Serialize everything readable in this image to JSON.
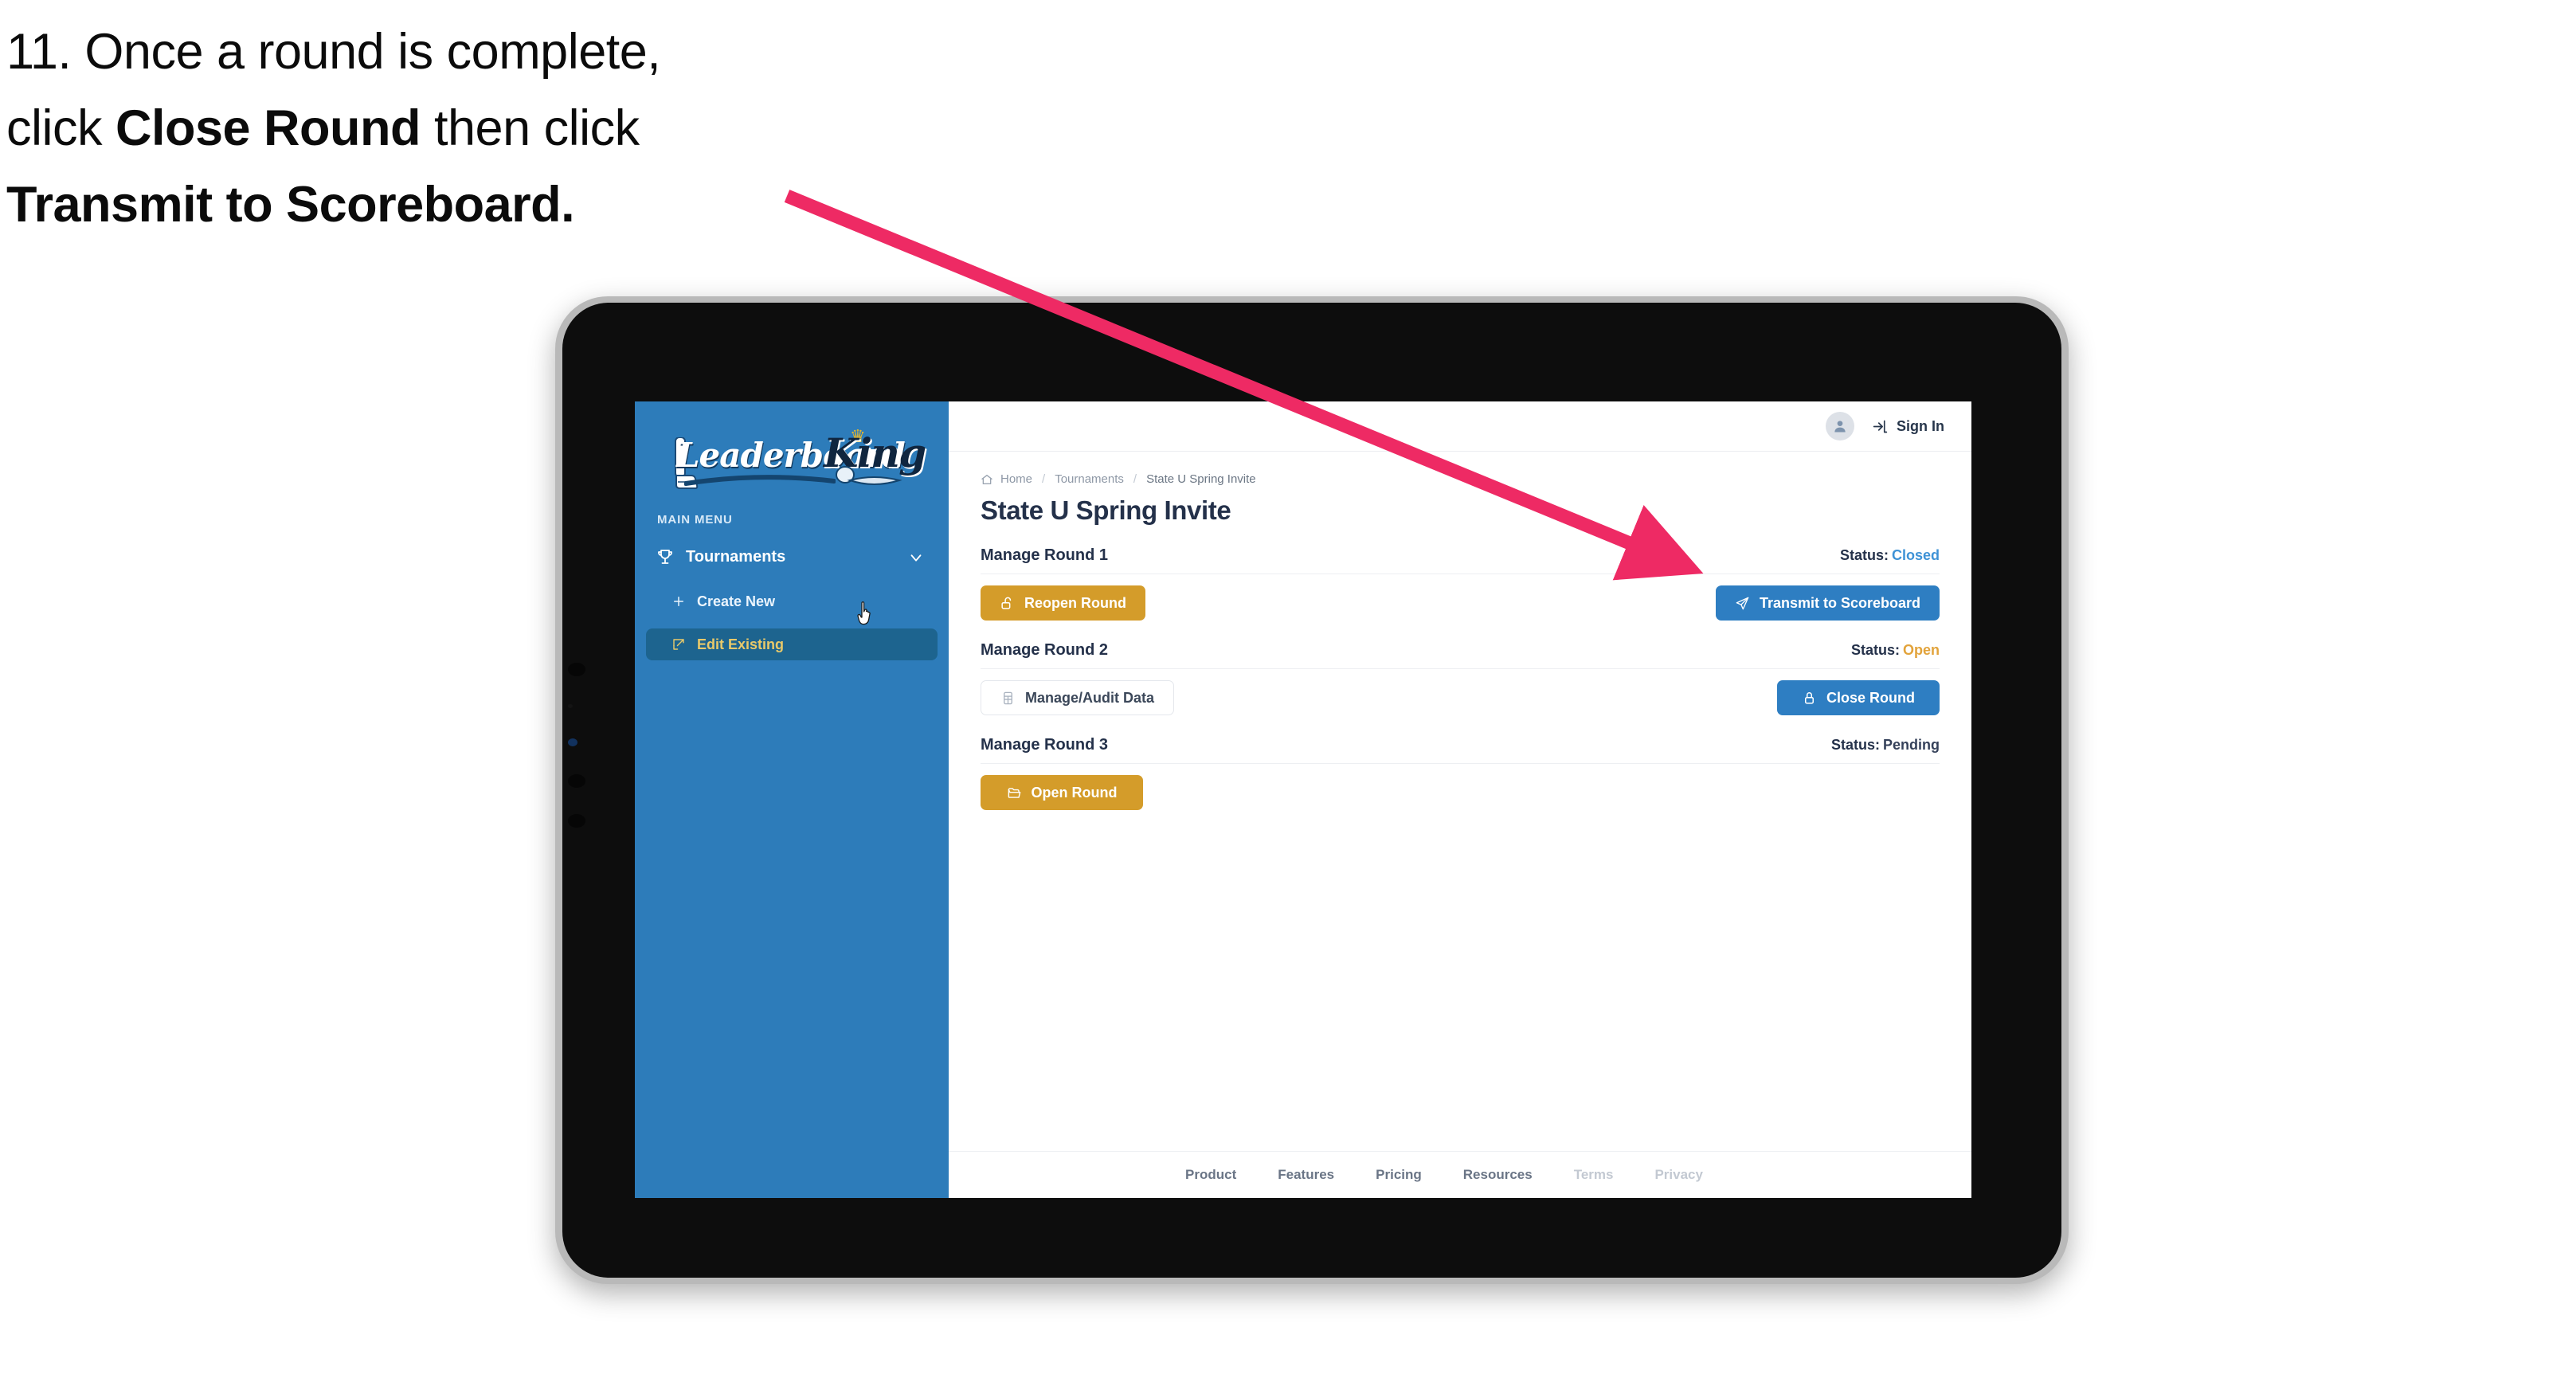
{
  "annotation": {
    "step_text_line1": "11. Once a round is complete,",
    "step_text_line2_pre": "click ",
    "step_text_line2_bold": "Close Round",
    "step_text_line2_post": " then click",
    "step_text_line3_bold": "Transmit to Scoreboard.",
    "arrow_color": "#ee2a64"
  },
  "sidebar": {
    "logo_leaderboard": "Leaderboard",
    "logo_king": "King",
    "menu_label": "MAIN MENU",
    "nav": {
      "tournaments_label": "Tournaments",
      "tournaments_icon": "trophy-icon",
      "chevron_icon": "chevron-down-icon"
    },
    "sub_items": [
      {
        "label": "Create New",
        "icon": "plus-icon",
        "active": false
      },
      {
        "label": "Edit Existing",
        "icon": "edit-square-icon",
        "active": true
      }
    ],
    "background_color": "#2d7cba",
    "active_background_color": "#1d648f",
    "active_text_color": "#e8c96a"
  },
  "topbar": {
    "avatar_icon": "user-avatar-icon",
    "signin_icon": "login-arrow-icon",
    "signin_label": "Sign In"
  },
  "breadcrumb": {
    "home_icon": "home-icon",
    "items": [
      "Home",
      "Tournaments",
      "State U Spring Invite"
    ],
    "separator": "/"
  },
  "page": {
    "title": "State U Spring Invite"
  },
  "rounds": [
    {
      "name": "Manage Round 1",
      "status_label": "Status:",
      "status_value": "Closed",
      "status_color": "#3e92d6",
      "left_button": {
        "label": "Reopen Round",
        "icon": "unlock-icon",
        "style": "gold"
      },
      "right_button": {
        "label": "Transmit to Scoreboard",
        "icon": "send-plane-icon",
        "style": "blue"
      }
    },
    {
      "name": "Manage Round 2",
      "status_label": "Status:",
      "status_value": "Open",
      "status_color": "#e2a33b",
      "left_button": {
        "label": "Manage/Audit Data",
        "icon": "table-grid-icon",
        "style": "white"
      },
      "right_button": {
        "label": "Close Round",
        "icon": "lock-icon",
        "style": "blue"
      }
    },
    {
      "name": "Manage Round 3",
      "status_label": "Status:",
      "status_value": "Pending",
      "status_color": "#35415a",
      "left_button": {
        "label": "Open Round",
        "icon": "folder-open-icon",
        "style": "gold"
      },
      "right_button": null
    }
  ],
  "footer": {
    "links": [
      {
        "label": "Product",
        "dim": false
      },
      {
        "label": "Features",
        "dim": false
      },
      {
        "label": "Pricing",
        "dim": false
      },
      {
        "label": "Resources",
        "dim": false
      },
      {
        "label": "Terms",
        "dim": true
      },
      {
        "label": "Privacy",
        "dim": true
      }
    ]
  },
  "cursor": {
    "icon": "pointing-hand-cursor"
  }
}
